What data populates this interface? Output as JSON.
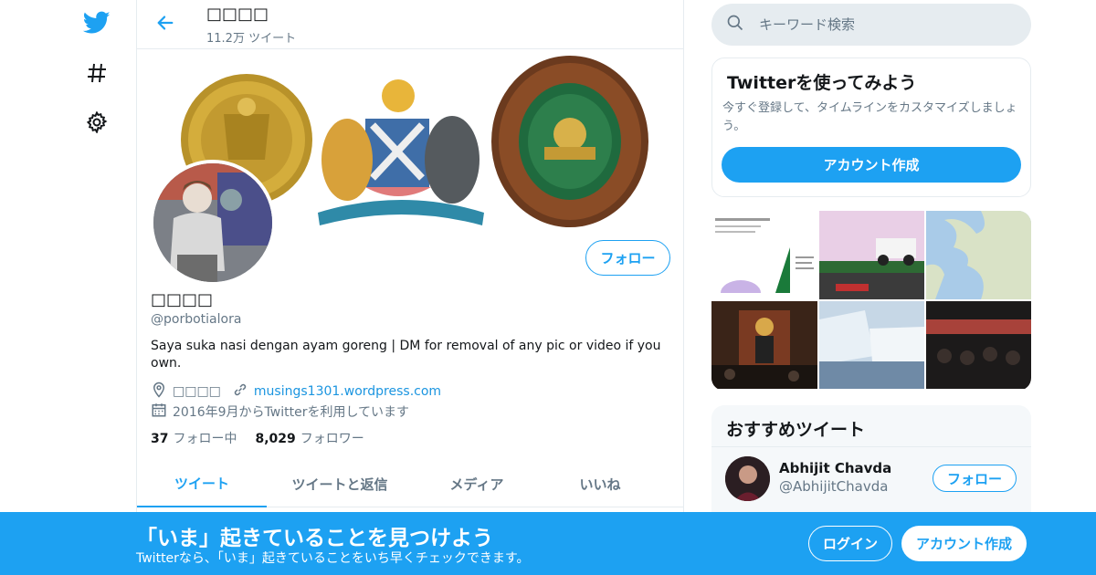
{
  "profile": {
    "header_name": "□□□□",
    "tweet_count": "11.2万 ツイート",
    "name": "□□□□",
    "handle": "@porbotialora",
    "bio": "Saya suka nasi dengan ayam goreng | DM for removal of any pic or video if you own.",
    "location": "□□□□",
    "website": "musings1301.wordpress.com",
    "joined": "2016年9月からTwitterを利用しています",
    "following_count": "37",
    "following_label": "フォロー中",
    "followers_count": "8,029",
    "followers_label": "フォロワー",
    "follow_label": "フォロー"
  },
  "tabs": [
    "ツイート",
    "ツイートと返信",
    "メディア",
    "いいね"
  ],
  "search": {
    "placeholder": "キーワード検索"
  },
  "signup_card": {
    "title": "Twitterを使ってみよう",
    "text": "今すぐ登録して、タイムラインをカスタマイズしましょう。",
    "button": "アカウント作成"
  },
  "recommended": {
    "title": "おすすめツイート",
    "user_name": "Abhijit Chavda",
    "user_handle": "@AbhijitChavda",
    "follow_label": "フォロー"
  },
  "bottom_bar": {
    "headline": "「いま」起きていることを見つけよう",
    "subtext": "Twitterなら、「いま」起きていることをいち早くチェックできます。",
    "login": "ログイン",
    "signup": "アカウント作成"
  },
  "colors": {
    "accent": "#1da1f2",
    "text": "#14171a",
    "muted": "#657786",
    "border": "#e6ecf0"
  },
  "icons": [
    "twitter-bird-icon",
    "hashtag-icon",
    "gear-icon",
    "back-arrow-icon",
    "search-icon",
    "location-icon",
    "link-icon",
    "calendar-icon"
  ]
}
